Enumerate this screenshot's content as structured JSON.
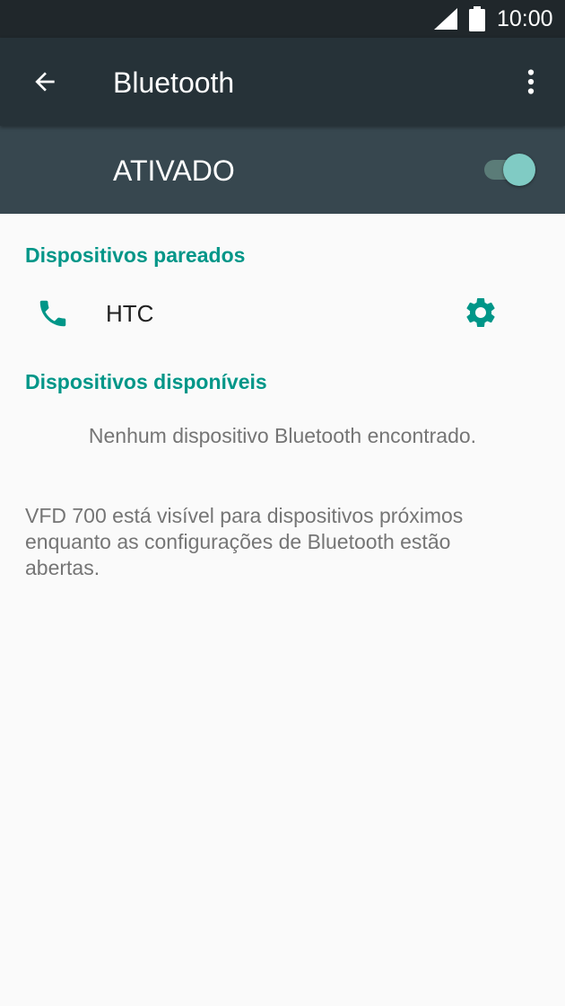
{
  "status_bar": {
    "time": "10:00"
  },
  "app_bar": {
    "title": "Bluetooth"
  },
  "bluetooth_switch": {
    "label": "ATIVADO",
    "on": true
  },
  "paired": {
    "header": "Dispositivos pareados",
    "devices": [
      {
        "name": "HTC",
        "icon": "phone-icon"
      }
    ]
  },
  "available": {
    "header": "Dispositivos disponíveis",
    "empty_message": "Nenhum dispositivo Bluetooth encontrado."
  },
  "visibility_note": "VFD 700 está visível para dispositivos próximos enquanto as configurações de Bluetooth estão abertas.",
  "colors": {
    "accent": "#009688",
    "toolbar": "#263238",
    "switch_bar": "#37474f",
    "status_bar": "#20272b"
  }
}
